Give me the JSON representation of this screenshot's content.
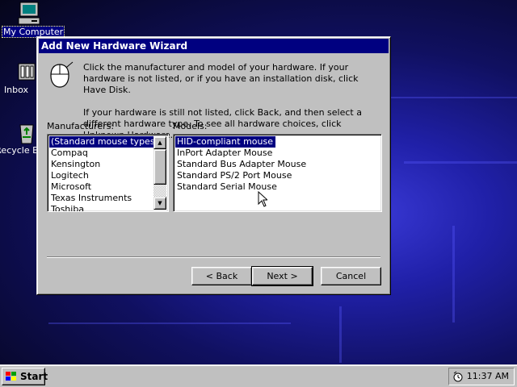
{
  "desktop": {
    "icons": [
      {
        "label": "My Computer"
      },
      {
        "label": "Inbox"
      },
      {
        "label": "Recycle Bin"
      }
    ]
  },
  "dialog": {
    "title": "Add New Hardware Wizard",
    "intro_p1": "Click the manufacturer and model of your hardware. If your hardware is not listed, or if you have an installation disk, click Have Disk.",
    "intro_p2": "If your hardware is still not listed, click Back, and then select a different hardware type. To see all hardware choices, click Unknown Hardware.",
    "manufacturers_label": "Manufacturers:",
    "models_label": "Models:",
    "manufacturers": [
      "(Standard mouse types)",
      "Compaq",
      "Kensington",
      "Logitech",
      "Microsoft",
      "Texas Instruments",
      "Toshiba"
    ],
    "models": [
      "HID-compliant mouse",
      "InPort Adapter Mouse",
      "Standard Bus Adapter Mouse",
      "Standard PS/2 Port Mouse",
      "Standard Serial Mouse"
    ],
    "buttons": {
      "back": "< Back",
      "next": "Next >",
      "cancel": "Cancel"
    }
  },
  "taskbar": {
    "start_label": "Start",
    "clock": "11:37 AM"
  },
  "colors": {
    "selection": "#000080",
    "face": "#c0c0c0"
  }
}
